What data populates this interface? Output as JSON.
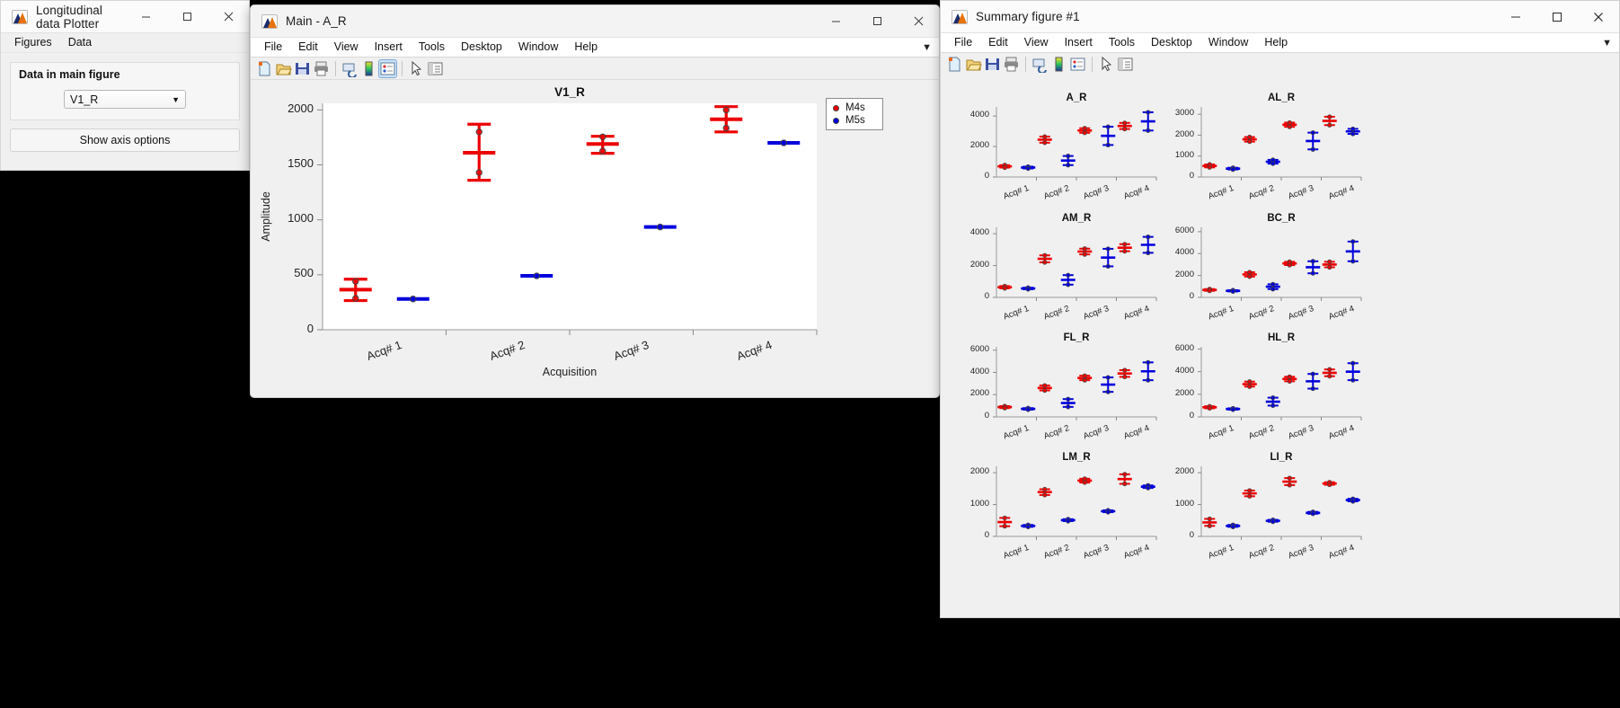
{
  "plotter_window": {
    "title": "Longitudinal data Plotter",
    "icon": "matlab-icon",
    "menus": [
      "Figures",
      "Data"
    ],
    "group_title": "Data in main figure",
    "dropdown_value": "V1_R",
    "dropdown_caret": "▼",
    "button_label": "Show axis options",
    "window_buttons": [
      "minimize",
      "maximize",
      "close"
    ]
  },
  "main_figure_window": {
    "title": "Main - A_R",
    "icon": "matlab-icon",
    "menus": [
      "File",
      "Edit",
      "View",
      "Insert",
      "Tools",
      "Desktop",
      "Window",
      "Help"
    ],
    "toolbar_icons": [
      "new-figure-icon",
      "open-file-icon",
      "save-figure-icon",
      "print-figure-icon",
      "link-plot-icon",
      "colorbar-icon",
      "legend-icon",
      "pointer-icon",
      "plot-browser-icon"
    ],
    "overflow_arrow": "▼"
  },
  "summary_figure_window": {
    "title": "Summary figure #1",
    "icon": "matlab-icon",
    "menus": [
      "File",
      "Edit",
      "View",
      "Insert",
      "Tools",
      "Desktop",
      "Window",
      "Help"
    ],
    "toolbar_icons": [
      "new-figure-icon",
      "open-file-icon",
      "save-figure-icon",
      "print-figure-icon",
      "link-plot-icon",
      "colorbar-icon",
      "legend-icon",
      "pointer-icon",
      "plot-browser-icon"
    ],
    "overflow_arrow": "▼"
  },
  "colors": {
    "m4s": "#ee0000",
    "m5s": "#0000dd",
    "marker_edge": "#444444",
    "axes_bg": "#ffffff",
    "figure_bg": "#f0f0f0"
  },
  "legend": {
    "entries": [
      {
        "label": "M4s",
        "color": "#ee0000"
      },
      {
        "label": "M5s",
        "color": "#0000dd"
      }
    ]
  },
  "chart_data": [
    {
      "id": "main",
      "type": "scatter",
      "title": "V1_R",
      "xlabel": "Acquisition",
      "ylabel": "Amplitude",
      "categories": [
        "Acq# 1",
        "Acq# 2",
        "Acq# 3",
        "Acq# 4"
      ],
      "yticks": [
        0,
        500,
        1000,
        1500,
        2000
      ],
      "ylim": [
        0,
        2060
      ],
      "grid": false,
      "series": [
        {
          "name": "M4s",
          "color": "#ee0000",
          "means": [
            365,
            1610,
            1690,
            1915
          ],
          "err_low": [
            265,
            1360,
            1605,
            1800
          ],
          "err_high": [
            460,
            1870,
            1760,
            2030
          ],
          "points": [
            [
              440,
              285
            ],
            [
              1800,
              1430
            ],
            [
              1755,
              1625
            ],
            [
              2000,
              1835
            ]
          ]
        },
        {
          "name": "M5s",
          "color": "#0000dd",
          "means": [
            280,
            490,
            935,
            1700
          ],
          "err_low": [
            280,
            490,
            935,
            1700
          ],
          "err_high": [
            280,
            490,
            935,
            1700
          ],
          "points": [
            [
              280
            ],
            [
              490
            ],
            [
              935
            ],
            [
              1700
            ]
          ]
        }
      ]
    },
    {
      "id": "A_R",
      "type": "scatter",
      "title": "A_R",
      "categories": [
        "Acq# 1",
        "Acq# 2",
        "Acq# 3",
        "Acq# 4"
      ],
      "yticks": [
        0,
        2000,
        4000
      ],
      "ylim": [
        0,
        4600
      ],
      "series": [
        {
          "name": "M4s",
          "color": "#ee0000",
          "means": [
            700,
            2450,
            3050,
            3350
          ],
          "err_low": [
            620,
            2250,
            2900,
            3150
          ],
          "err_high": [
            780,
            2650,
            3200,
            3550
          ]
        },
        {
          "name": "M5s",
          "color": "#0000dd",
          "means": [
            620,
            1080,
            2700,
            3650
          ],
          "err_low": [
            560,
            780,
            2100,
            3050
          ],
          "err_high": [
            680,
            1380,
            3300,
            4250
          ]
        }
      ]
    },
    {
      "id": "AL_R",
      "type": "scatter",
      "title": "AL_R",
      "categories": [
        "Acq# 1",
        "Acq# 2",
        "Acq# 3",
        "Acq# 4"
      ],
      "yticks": [
        0,
        1000,
        2000,
        3000
      ],
      "ylim": [
        0,
        3350
      ],
      "series": [
        {
          "name": "M4s",
          "color": "#ee0000",
          "means": [
            530,
            1800,
            2500,
            2680
          ],
          "err_low": [
            460,
            1690,
            2400,
            2480
          ],
          "err_high": [
            600,
            1910,
            2600,
            2880
          ]
        },
        {
          "name": "M5s",
          "color": "#0000dd",
          "means": [
            400,
            730,
            1720,
            2180
          ],
          "err_low": [
            360,
            640,
            1320,
            2060
          ],
          "err_high": [
            440,
            820,
            2120,
            2300
          ]
        }
      ]
    },
    {
      "id": "AM_R",
      "type": "scatter",
      "title": "AM_R",
      "categories": [
        "Acq# 1",
        "Acq# 2",
        "Acq# 3",
        "Acq# 4"
      ],
      "yticks": [
        0,
        2000,
        4000
      ],
      "ylim": [
        0,
        4400
      ],
      "series": [
        {
          "name": "M4s",
          "color": "#ee0000",
          "means": [
            640,
            2420,
            2880,
            3120
          ],
          "err_low": [
            570,
            2200,
            2700,
            2900
          ],
          "err_high": [
            710,
            2640,
            3060,
            3340
          ]
        },
        {
          "name": "M5s",
          "color": "#0000dd",
          "means": [
            560,
            1100,
            2500,
            3300
          ],
          "err_low": [
            510,
            800,
            1950,
            2800
          ],
          "err_high": [
            610,
            1400,
            3050,
            3800
          ]
        }
      ]
    },
    {
      "id": "BC_R",
      "type": "scatter",
      "title": "BC_R",
      "categories": [
        "Acq# 1",
        "Acq# 2",
        "Acq# 3",
        "Acq# 4"
      ],
      "yticks": [
        0,
        2000,
        4000,
        6000
      ],
      "ylim": [
        0,
        6400
      ],
      "series": [
        {
          "name": "M4s",
          "color": "#ee0000",
          "means": [
            680,
            2100,
            3100,
            3000
          ],
          "err_low": [
            600,
            1900,
            2950,
            2750
          ],
          "err_high": [
            760,
            2300,
            3250,
            3250
          ]
        },
        {
          "name": "M5s",
          "color": "#0000dd",
          "means": [
            600,
            980,
            2750,
            4200
          ],
          "err_low": [
            540,
            760,
            2200,
            3300
          ],
          "err_high": [
            660,
            1200,
            3300,
            5100
          ]
        }
      ]
    },
    {
      "id": "FL_R",
      "type": "scatter",
      "title": "FL_R",
      "categories": [
        "Acq# 1",
        "Acq# 2",
        "Acq# 3",
        "Acq# 4"
      ],
      "yticks": [
        0,
        2000,
        4000,
        6000
      ],
      "ylim": [
        0,
        6300
      ],
      "series": [
        {
          "name": "M4s",
          "color": "#ee0000",
          "means": [
            880,
            2600,
            3500,
            3900
          ],
          "err_low": [
            790,
            2380,
            3300,
            3600
          ],
          "err_high": [
            970,
            2820,
            3700,
            4200
          ]
        },
        {
          "name": "M5s",
          "color": "#0000dd",
          "means": [
            720,
            1250,
            2900,
            4100
          ],
          "err_low": [
            650,
            900,
            2250,
            3300
          ],
          "err_high": [
            790,
            1600,
            3550,
            4900
          ]
        }
      ]
    },
    {
      "id": "HL_R",
      "type": "scatter",
      "title": "HL_R",
      "categories": [
        "Acq# 1",
        "Acq# 2",
        "Acq# 3",
        "Acq# 4"
      ],
      "yticks": [
        0,
        2000,
        4000,
        6000
      ],
      "ylim": [
        0,
        6200
      ],
      "series": [
        {
          "name": "M4s",
          "color": "#ee0000",
          "means": [
            850,
            2900,
            3350,
            3900
          ],
          "err_low": [
            760,
            2680,
            3150,
            3600
          ],
          "err_high": [
            940,
            3120,
            3550,
            4200
          ]
        },
        {
          "name": "M5s",
          "color": "#0000dd",
          "means": [
            700,
            1350,
            3150,
            4000
          ],
          "err_low": [
            640,
            1000,
            2500,
            3250
          ],
          "err_high": [
            760,
            1700,
            3800,
            4750
          ]
        }
      ]
    },
    {
      "id": "LM_R",
      "type": "scatter",
      "title": "LM_R",
      "categories": [
        "Acq# 1",
        "Acq# 2",
        "Acq# 3",
        "Acq# 4"
      ],
      "yticks": [
        0,
        1000,
        2000
      ],
      "ylim": [
        0,
        2200
      ],
      "series": [
        {
          "name": "M4s",
          "color": "#ee0000",
          "means": [
            450,
            1390,
            1750,
            1800
          ],
          "err_low": [
            320,
            1300,
            1690,
            1650
          ],
          "err_high": [
            580,
            1480,
            1810,
            1950
          ]
        },
        {
          "name": "M5s",
          "color": "#0000dd",
          "means": [
            330,
            510,
            790,
            1560
          ],
          "err_low": [
            300,
            480,
            760,
            1520
          ],
          "err_high": [
            360,
            540,
            820,
            1600
          ]
        }
      ]
    },
    {
      "id": "LI_R",
      "type": "scatter",
      "title": "LI_R",
      "categories": [
        "Acq# 1",
        "Acq# 2",
        "Acq# 3",
        "Acq# 4"
      ],
      "yticks": [
        0,
        1000,
        2000
      ],
      "ylim": [
        0,
        2200
      ],
      "series": [
        {
          "name": "M4s",
          "color": "#ee0000",
          "means": [
            440,
            1350,
            1720,
            1660
          ],
          "err_low": [
            330,
            1260,
            1610,
            1620
          ],
          "err_high": [
            550,
            1440,
            1830,
            1700
          ]
        },
        {
          "name": "M5s",
          "color": "#0000dd",
          "means": [
            330,
            490,
            740,
            1140
          ],
          "err_low": [
            300,
            460,
            710,
            1100
          ],
          "err_high": [
            360,
            520,
            770,
            1180
          ]
        }
      ]
    }
  ]
}
